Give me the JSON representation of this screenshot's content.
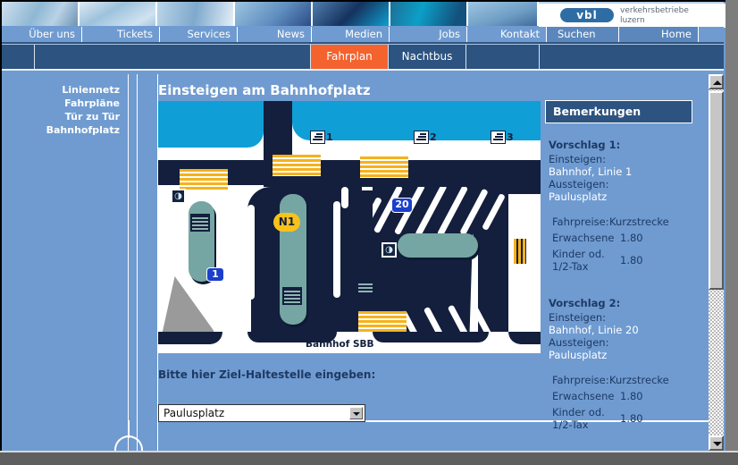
{
  "window": {
    "scrollbar": {
      "up_icon": "scroll-up-arrow",
      "down_icon": "scroll-down-arrow"
    }
  },
  "brand": {
    "logo_mark": "vbl",
    "logo_line1": "verkehrsbetriebe",
    "logo_line2": "luzern"
  },
  "nav": {
    "items": [
      {
        "label": "Über uns"
      },
      {
        "label": "Tickets"
      },
      {
        "label": "Services"
      },
      {
        "label": "News"
      },
      {
        "label": "Medien"
      },
      {
        "label": "Jobs"
      },
      {
        "label": "Kontakt"
      },
      {
        "label": "Suchen"
      },
      {
        "label": "Home"
      }
    ]
  },
  "subnav": {
    "items": [
      {
        "label": "Fahrplan",
        "active": true
      },
      {
        "label": "Nachtbus",
        "active": false
      }
    ],
    "active_color": "#f4622e"
  },
  "sidebar": {
    "items": [
      {
        "label": "Liniennetz"
      },
      {
        "label": "Fahrpläne"
      },
      {
        "label": "Tür zu Tür"
      },
      {
        "label": "Bahnhofplatz"
      }
    ]
  },
  "main": {
    "title": "Einsteigen am Bahnhofplatz",
    "map": {
      "station_label": "Bahnhof SBB",
      "stop_badges": [
        {
          "label": "1",
          "type": "blue"
        },
        {
          "label": "N1",
          "type": "yellow"
        },
        {
          "label": "20",
          "type": "blue"
        }
      ],
      "access_icons": [
        {
          "label": "1",
          "icon": "stairs-icon"
        },
        {
          "label": "2",
          "icon": "stairs-icon"
        },
        {
          "label": "3",
          "icon": "stairs-icon"
        }
      ],
      "elevator_icon": "elevator-icon",
      "colors": {
        "road": "#131f3d",
        "water": "#0f9ed6",
        "pavement": "#ffffff",
        "platform": "#76a6a3",
        "crosswalk": "#f6b21b",
        "building": "#9a9a9a"
      }
    },
    "form": {
      "label": "Bitte hier Ziel-Haltestelle eingeben:",
      "select_value": "Paulusplatz",
      "dropdown_icon": "chevron-down-icon"
    }
  },
  "remarks": {
    "heading": "Bemerkungen",
    "proposals": [
      {
        "title": "Vorschlag 1:",
        "board_label": "Einsteigen:",
        "board_value": "Bahnhof, Linie 1",
        "alight_label": "Aussteigen:",
        "alight_value": "Paulusplatz",
        "fare_label": "Fahrpreise:",
        "fare_value": "Kurzstrecke",
        "adult_label": "Erwachsene",
        "adult_price": "1.80",
        "child_label_1": "Kinder od.",
        "child_label_2": "1/2-Tax",
        "child_price": "1.80"
      },
      {
        "title": "Vorschlag 2:",
        "board_label": "Einsteigen:",
        "board_value": "Bahnhof, Linie 20",
        "alight_label": "Aussteigen:",
        "alight_value": "Paulusplatz",
        "fare_label": "Fahrpreise:",
        "fare_value": "Kurzstrecke",
        "adult_label": "Erwachsene",
        "adult_price": "1.80",
        "child_label_1": "Kinder od.",
        "child_label_2": "1/2-Tax",
        "child_price": "1.80"
      }
    ]
  }
}
